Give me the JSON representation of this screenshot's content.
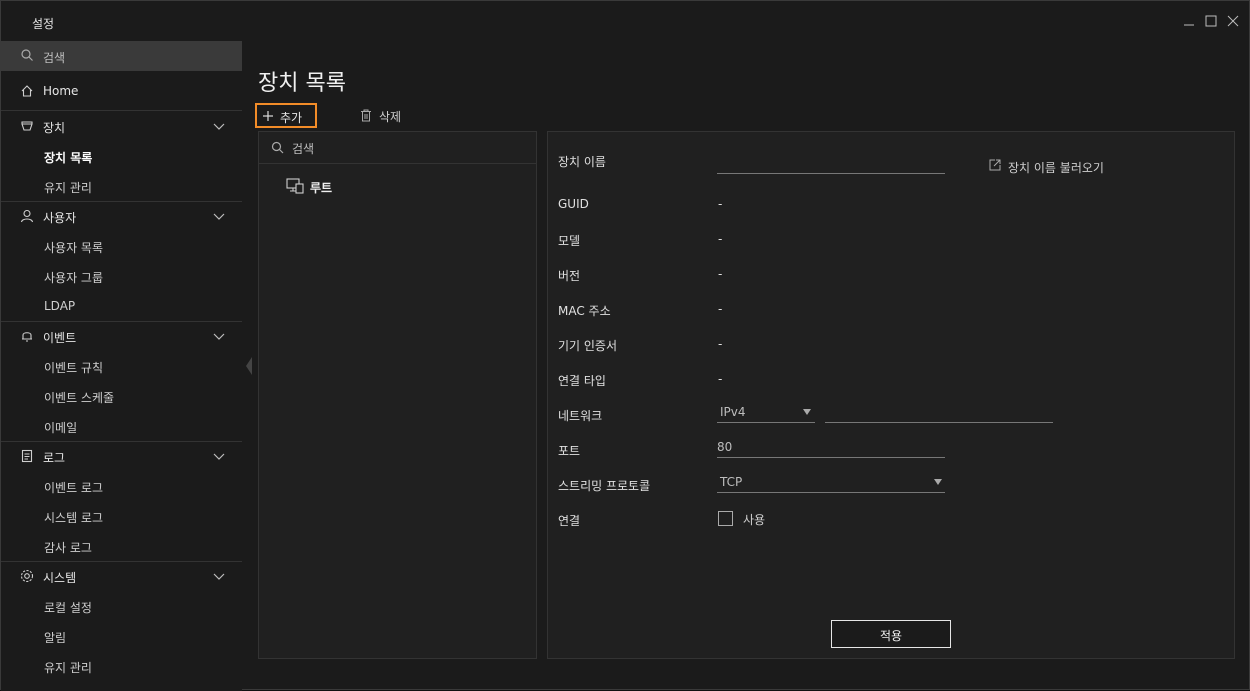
{
  "window": {
    "title": "설정",
    "controls": {
      "minimize": "minimize-icon",
      "maximize": "maximize-icon",
      "close": "close-icon"
    }
  },
  "sidebar": {
    "search_placeholder": "검색",
    "home": "Home",
    "groups": [
      {
        "label": "장치",
        "icon": "device-icon",
        "items": [
          "장치 목록",
          "유지 관리"
        ]
      },
      {
        "label": "사용자",
        "icon": "user-icon",
        "items": [
          "사용자 목록",
          "사용자 그룹",
          "LDAP"
        ]
      },
      {
        "label": "이벤트",
        "icon": "bell-icon",
        "items": [
          "이벤트 규칙",
          "이벤트 스케줄",
          "이메일"
        ]
      },
      {
        "label": "로그",
        "icon": "log-icon",
        "items": [
          "이벤트 로그",
          "시스템 로그",
          "감사 로그"
        ]
      },
      {
        "label": "시스템",
        "icon": "gear-icon",
        "items": [
          "로컬 설정",
          "알림",
          "유지 관리"
        ]
      }
    ],
    "active_item": "장치 목록"
  },
  "main": {
    "title": "장치 목록",
    "toolbar": {
      "add_label": "추가",
      "delete_label": "삭제"
    },
    "tree": {
      "search_placeholder": "검색",
      "root_label": "루트"
    },
    "detail": {
      "device_name": {
        "label": "장치 이름",
        "value": ""
      },
      "load_name_label": "장치 이름 불러오기",
      "fields": [
        {
          "label": "GUID",
          "value": "-"
        },
        {
          "label": "모델",
          "value": "-"
        },
        {
          "label": "버전",
          "value": "-"
        },
        {
          "label": "MAC 주소",
          "value": "-"
        },
        {
          "label": "기기 인증서",
          "value": "-"
        },
        {
          "label": "연결 타입",
          "value": "-"
        }
      ],
      "network": {
        "label": "네트워크",
        "selected": "IPv4",
        "address": ""
      },
      "port": {
        "label": "포트",
        "value": "80"
      },
      "streaming_protocol": {
        "label": "스트리밍 프로토콜",
        "selected": "TCP"
      },
      "connection": {
        "label": "연결",
        "checkbox_label": "사용",
        "checked": false
      },
      "apply_label": "적용"
    }
  },
  "colors": {
    "accent": "#f28c28",
    "bg": "#1b1b1b",
    "panel": "#202020",
    "search_bg": "#3a3a3a"
  }
}
